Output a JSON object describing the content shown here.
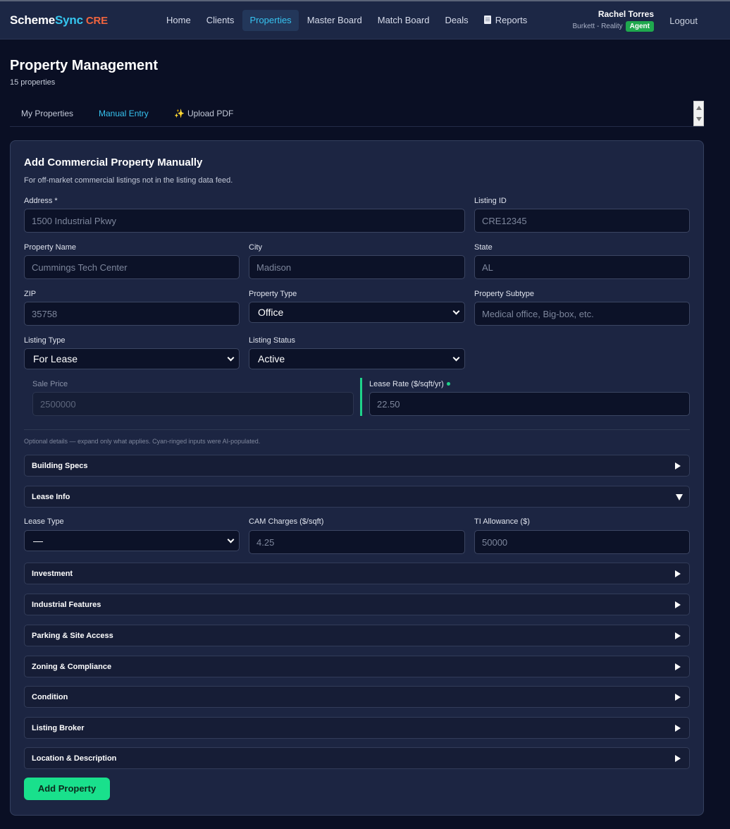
{
  "header": {
    "brand_part1": "Scheme",
    "brand_part2": "Sync",
    "brand_part3": "CRE",
    "nav": [
      "Home",
      "Clients",
      "Properties",
      "Master Board",
      "Match Board",
      "Deals",
      "Reports"
    ],
    "active_nav": "Properties",
    "user_name": "Rachel Torres",
    "user_org": "Burkett - Reality",
    "user_role": "Agent",
    "logout_label": "Logout"
  },
  "page": {
    "title": "Property Management",
    "subtitle": "15 properties"
  },
  "tabs": [
    "My Properties",
    "Manual Entry",
    "Upload PDF"
  ],
  "active_tab": "Manual Entry",
  "form": {
    "title": "Add Commercial Property Manually",
    "subtitle": "For off-market commercial listings not in the listing data feed.",
    "address": {
      "label": "Address *",
      "placeholder": "1500 Industrial Pkwy"
    },
    "listing_id": {
      "label": "Listing ID",
      "placeholder": "CRE12345"
    },
    "property_name": {
      "label": "Property Name",
      "placeholder": "Cummings Tech Center"
    },
    "city": {
      "label": "City",
      "placeholder": "Madison"
    },
    "state": {
      "label": "State",
      "placeholder": "AL"
    },
    "zip": {
      "label": "ZIP",
      "placeholder": "35758"
    },
    "property_type": {
      "label": "Property Type",
      "value": "Office"
    },
    "property_subtype": {
      "label": "Property Subtype",
      "placeholder": "Medical office, Big-box, etc."
    },
    "listing_type": {
      "label": "Listing Type",
      "value": "For Lease"
    },
    "listing_status": {
      "label": "Listing Status",
      "value": "Active"
    },
    "sale_price": {
      "label": "Sale Price",
      "placeholder": "2500000"
    },
    "lease_rate": {
      "label": "Lease Rate ($/sqft/yr)",
      "placeholder": "22.50"
    },
    "hint": "Optional details — expand only what applies. Cyan-ringed inputs were AI-populated.",
    "lease_type": {
      "label": "Lease Type",
      "value": "—"
    },
    "cam_charges": {
      "label": "CAM Charges ($/sqft)",
      "placeholder": "4.25"
    },
    "ti_allowance": {
      "label": "TI Allowance ($)",
      "placeholder": "50000"
    },
    "sections": {
      "building_specs": "Building Specs",
      "lease_info": "Lease Info",
      "investment": "Investment",
      "industrial": "Industrial Features",
      "parking": "Parking & Site Access",
      "zoning": "Zoning & Compliance",
      "condition": "Condition",
      "broker": "Listing Broker",
      "location": "Location & Description"
    },
    "submit_label": "Add Property"
  },
  "colors": {
    "accent_cyan": "#36c3f0",
    "accent_green": "#19e08c",
    "brand_orange": "#f0643e",
    "background": "#0a0f24",
    "card": "#1c2542"
  }
}
